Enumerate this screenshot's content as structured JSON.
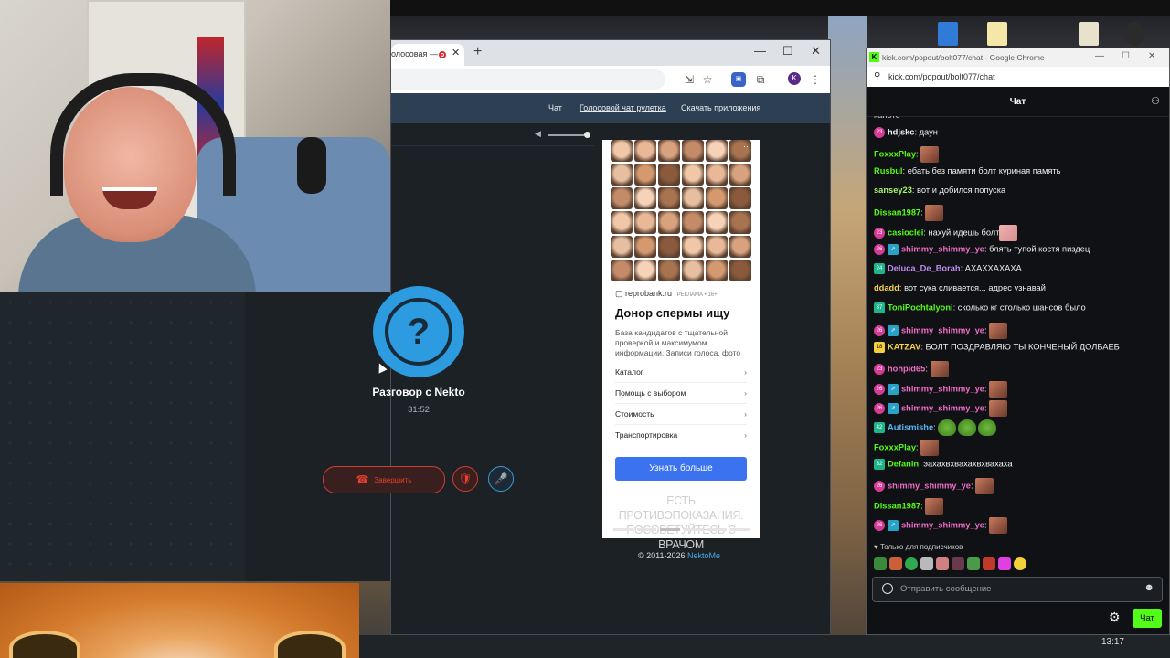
{
  "browser": {
    "tab_title": "олосовая —",
    "tab_close": "✕",
    "new_tab": "+",
    "min": "—",
    "max": "☐",
    "close": "✕",
    "profile_initial": "K"
  },
  "site": {
    "nav": [
      "Чат",
      "Голосовой чат рулетка",
      "Скачать приложения"
    ],
    "copyright": "© 2011-2026",
    "copyright_link": "NektoMe"
  },
  "call": {
    "avatar_glyph": "?",
    "title": "Разговор с Nekto",
    "timer": "31:52",
    "end_label": "Завершить",
    "end_icon": "☎",
    "shield_icon": "🛡",
    "mic_icon": "🎤"
  },
  "ad": {
    "source": "reprobank.ru",
    "source_tag": "РЕКЛАМА • 16+",
    "title": "Донор спермы ищу",
    "description": "База кандидатов с тщательной проверкой и максимумом информации. Записи голоса, фото",
    "links": [
      "Каталог",
      "Помощь с выбором",
      "Стоимость",
      "Транспортировка"
    ],
    "chevron": "›",
    "button": "Узнать больше",
    "warning": "ЕСТЬ ПРОТИВОПОКАЗАНИЯ. ПОСОВЕТУЙТЕСЬ С ВРАЧОМ",
    "dots": "⋯"
  },
  "side_fragment": "P",
  "kick": {
    "window_title": "kick.com/popout/bolt077/chat - Google Chrome",
    "logo": "K",
    "url": "kick.com/popout/bolt077/chat",
    "header": "Чат",
    "partial_top": "капоте",
    "messages": [
      {
        "badges": [
          "23"
        ],
        "user": "hdjskc",
        "color": "#f2f2f2",
        "text": "даун",
        "emotes": 0
      },
      {
        "badges": [],
        "user": "FoxxxPlay",
        "color": "#53fc18",
        "text": "",
        "emotes": 1
      },
      {
        "badges": [],
        "user": "Rusbul",
        "color": "#53fc18",
        "text": "ебать без памяти болт куриная память",
        "emotes": 0
      },
      {
        "badges": [],
        "user": "sansey23",
        "color": "#a6f26b",
        "text": "вот и добился попуска",
        "emotes": 0
      },
      {
        "badges": [],
        "user": "Dissan1987",
        "color": "#53fc18",
        "text": "",
        "emotes": 1
      },
      {
        "badges": [
          "23"
        ],
        "user": "casioclei",
        "color": "#53fc18",
        "text": "нахуй идешь болт",
        "emotes": 1
      },
      {
        "badges": [
          "26",
          "sub"
        ],
        "user": "shimmy_shimmy_ye",
        "color": "#f06cc7",
        "text": "блять тупой костя пиздец",
        "emotes": 0
      },
      {
        "badges": [
          "24g"
        ],
        "user": "Deluca_De_Borah",
        "color": "#c08cf0",
        "text": "АХАХХАХАХА",
        "emotes": 0
      },
      {
        "badges": [],
        "user": "ddadd",
        "color": "#f5d547",
        "text": "вот сука сливается... адрес узнавай",
        "emotes": 0
      },
      {
        "badges": [
          "37g"
        ],
        "user": "ToniPochtalyoni",
        "color": "#53fc18",
        "text": "сколько кг столько шансов было",
        "emotes": 0
      },
      {
        "badges": [
          "26",
          "sub"
        ],
        "user": "shimmy_shimmy_ye",
        "color": "#f06cc7",
        "text": "",
        "emotes": 1
      },
      {
        "badges": [
          "18sq"
        ],
        "user": "KATZAV",
        "color": "#f5d547",
        "text": "БОЛТ ПОЗДРАВЛЯЮ ТЫ КОНЧЕНЫЙ ДОЛБАЕБ",
        "emotes": 0
      },
      {
        "badges": [
          "23"
        ],
        "user": "hohpid65",
        "color": "#f06cc7",
        "text": "",
        "emotes": 1
      },
      {
        "badges": [
          "26",
          "sub"
        ],
        "user": "shimmy_shimmy_ye",
        "color": "#f06cc7",
        "text": "",
        "emotes": 1
      },
      {
        "badges": [
          "26",
          "sub"
        ],
        "user": "shimmy_shimmy_ye",
        "color": "#f06cc7",
        "text": "",
        "emotes": 1
      },
      {
        "badges": [
          "42g"
        ],
        "user": "Autismishe",
        "color": "#5ab4f2",
        "text": "",
        "emotes": 3
      },
      {
        "badges": [],
        "user": "FoxxxPlay",
        "color": "#53fc18",
        "text": "",
        "emotes": 1
      },
      {
        "badges": [
          "32g"
        ],
        "user": "Defanin",
        "color": "#53fc18",
        "text": "эахахвхвахахвхвахаха",
        "emotes": 0
      },
      {
        "badges": [
          "26"
        ],
        "user": "shimmy_shimmy_ye",
        "color": "#f06cc7",
        "text": "",
        "emotes": 1
      },
      {
        "badges": [],
        "user": "Dissan1987",
        "color": "#53fc18",
        "text": "",
        "emotes": 1
      },
      {
        "badges": [
          "26",
          "sub"
        ],
        "user": "shimmy_shimmy_ye",
        "color": "#f06cc7",
        "text": "",
        "emotes": 1
      }
    ],
    "subs_only": "♥ Только для подписчиков",
    "placeholder": "Отправить сообщение",
    "emoji_icon": "☻",
    "settings_icon": "⚙",
    "chat_button": "Чат"
  },
  "taskbar": {
    "time": "13:17"
  },
  "colors": {
    "accent_blue": "#2d9be0",
    "kick_green": "#53fc18",
    "end_red": "#e8412f",
    "ad_button": "#3b72f0"
  }
}
